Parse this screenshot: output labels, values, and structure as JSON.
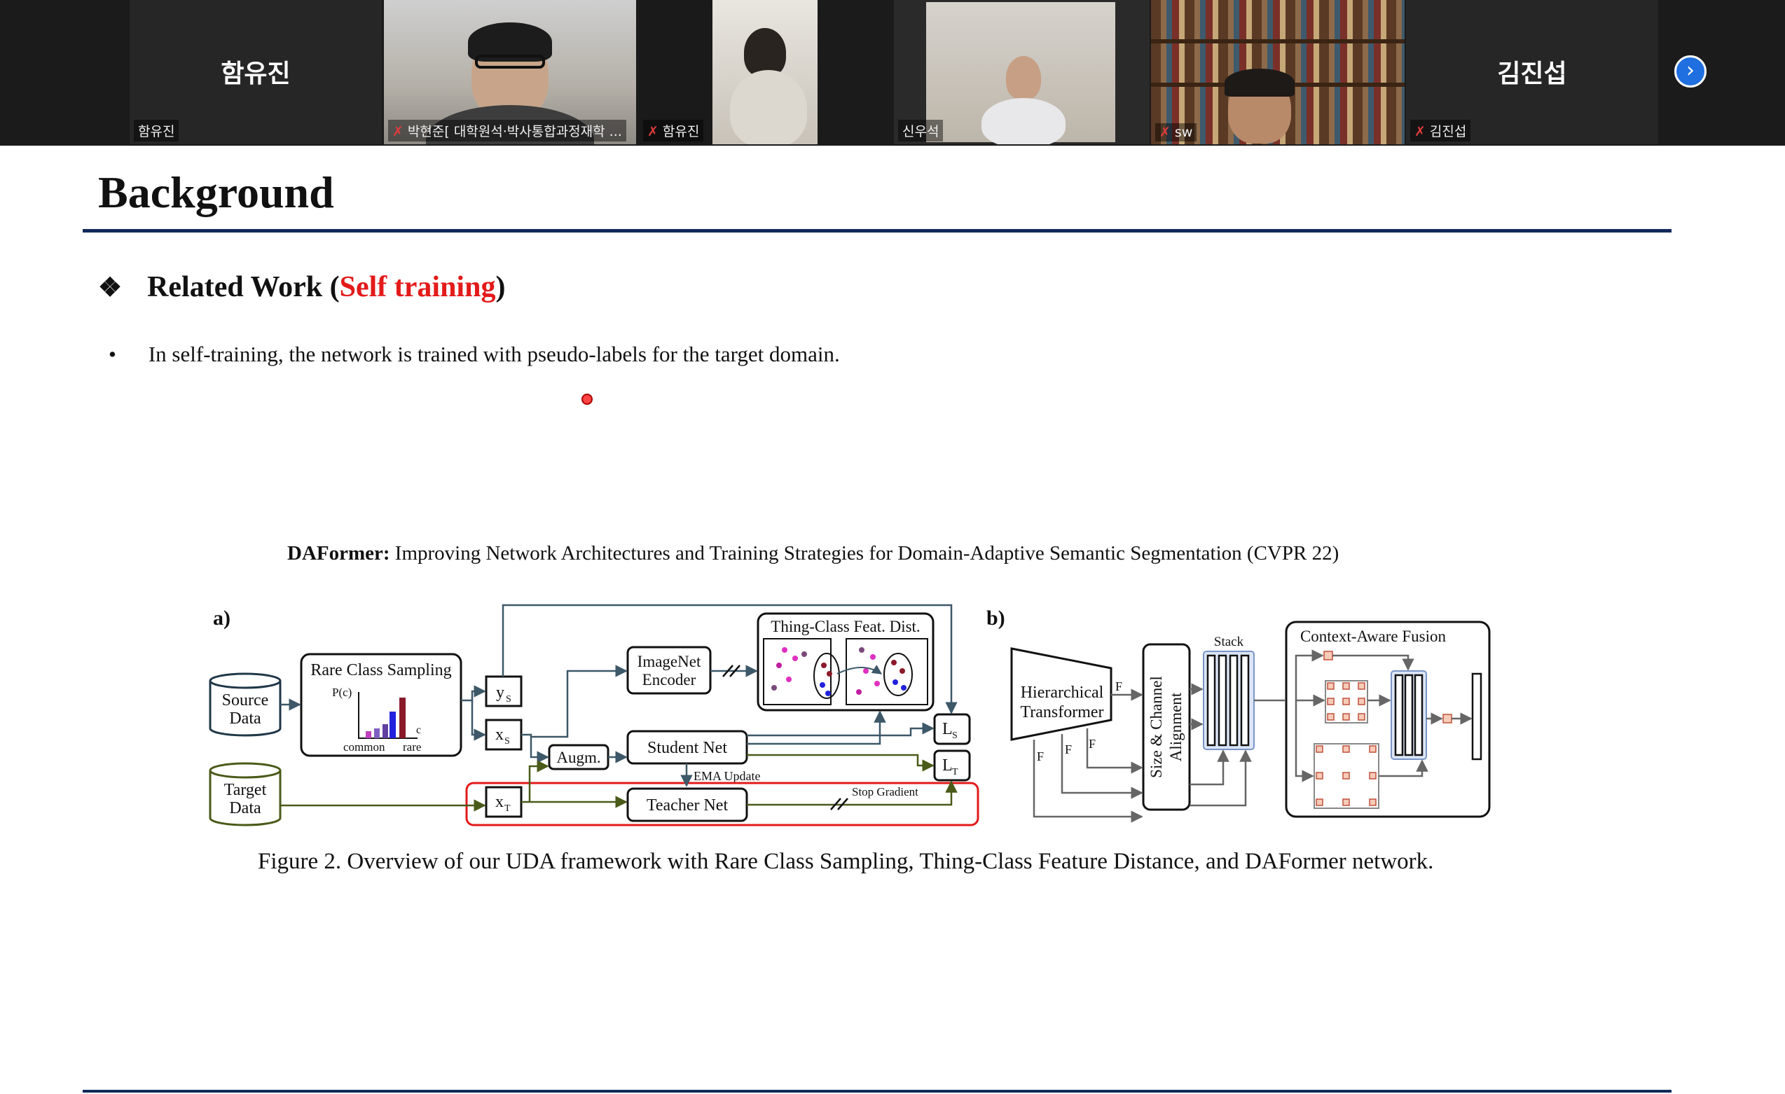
{
  "participants": [
    {
      "center_name": "함유진",
      "caption": "함유진",
      "muted": false
    },
    {
      "caption": "박현준[ 대학원석·박사통합과정재학 ...",
      "muted": true
    },
    {
      "caption": "함유진",
      "muted": true
    },
    {
      "caption": "신우석",
      "muted": false,
      "active_speaker": true
    },
    {
      "caption": "sw",
      "muted": true
    },
    {
      "center_name": "김진섭",
      "caption": "김진섭",
      "muted": true
    }
  ],
  "nav": {
    "next_icon": "chevron-right-icon",
    "next_glyph": "›"
  },
  "slide": {
    "title": "Background",
    "section_marker": "❖",
    "section_prefix": "Related Work (",
    "section_highlight": "Self training",
    "section_suffix": ")",
    "highlight_color": "#e31a1a",
    "bullet_marker": "•",
    "bullet": "In self-training, the network is trained with pseudo-labels for the target domain.",
    "citation_bold": "DAFormer:",
    "citation_rest": " Improving Network Architectures and Training Strategies for Domain-Adaptive Semantic Segmentation (CVPR 22)",
    "figure": {
      "panel_a": "a)",
      "panel_b": "b)",
      "source_data": [
        "Source",
        "Data"
      ],
      "target_data": [
        "Target",
        "Data"
      ],
      "rcs_title": "Rare Class Sampling",
      "rcs_pc": "P(c)",
      "rcs_c": "c",
      "rcs_common": "common",
      "rcs_rare": "rare",
      "ys": "y",
      "xs": "x",
      "xt": "x",
      "sub_s": "S",
      "sub_t": "T",
      "imagenet": [
        "ImageNet",
        "Encoder"
      ],
      "thing_class": "Thing-Class Feat. Dist.",
      "augm": "Augm.",
      "student": "Student Net",
      "teacher": "Teacher Net",
      "ema": "EMA Update",
      "stop_gradient": "Stop Gradient",
      "ls": "L",
      "lt": "L",
      "hier": [
        "Hierarchical",
        "Transformer"
      ],
      "f1": "F",
      "f2": "F",
      "f3": "F",
      "f4": "F",
      "size_channel": [
        "Size & Channel",
        "Alignment"
      ],
      "stack": "Stack",
      "context_fusion": "Context-Aware Fusion"
    },
    "caption": "Figure 2. Overview of our UDA framework with Rare Class Sampling, Thing-Class Feature Distance, and DAFormer network."
  }
}
